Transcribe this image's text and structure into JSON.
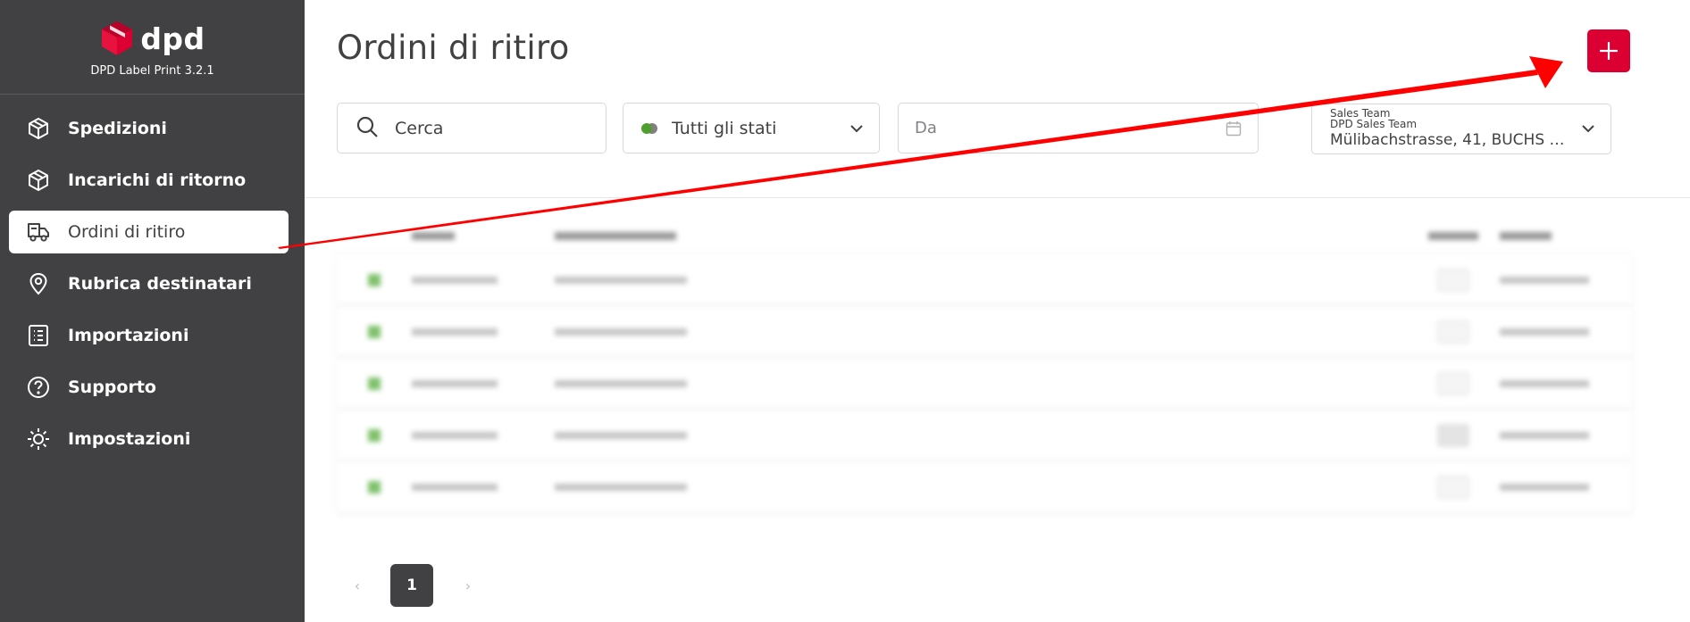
{
  "brand": {
    "name": "dpd",
    "version": "DPD Label Print 3.2.1",
    "color": "#dc0032"
  },
  "sidebar": {
    "items": [
      {
        "label": "Spedizioni",
        "icon": "package-icon",
        "active": false
      },
      {
        "label": "Incarichi di ritorno",
        "icon": "package-return-icon",
        "active": false
      },
      {
        "label": "Ordini di ritiro",
        "icon": "pickup-truck-icon",
        "active": true
      },
      {
        "label": "Rubrica destinatari",
        "icon": "location-pin-icon",
        "active": false
      },
      {
        "label": "Importazioni",
        "icon": "list-icon",
        "active": false
      },
      {
        "label": "Supporto",
        "icon": "help-circle-icon",
        "active": false
      },
      {
        "label": "Impostazioni",
        "icon": "gear-icon",
        "active": false
      }
    ]
  },
  "main": {
    "title": "Ordini di ritiro",
    "add_button_icon": "plus-icon"
  },
  "filters": {
    "search_placeholder": "Cerca",
    "status_label": "Tutti gli stati",
    "date_placeholder": "Da",
    "address_line1": "Sales Team",
    "address_line2": "DPD Sales Team",
    "address_line3": "Mülibachstrasse, 41, BUCHS ZH,..."
  },
  "pagination": {
    "current_page": "1",
    "prev": "‹",
    "next": "›"
  },
  "colors": {
    "sidebar_bg": "#414042",
    "accent": "#dc0032",
    "status_green": "#509e2f",
    "annotation_arrow": "#ff0000"
  }
}
